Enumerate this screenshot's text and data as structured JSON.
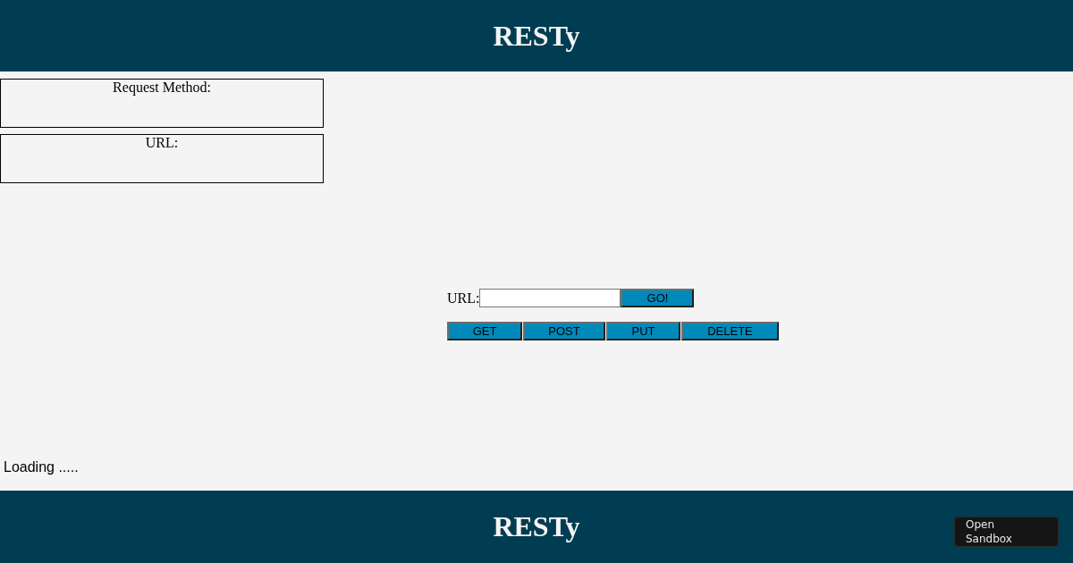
{
  "header": {
    "title": "RESTy"
  },
  "summary": [
    {
      "label": "Request Method:"
    },
    {
      "label": "URL:"
    }
  ],
  "form": {
    "url_label": "URL:",
    "submit_button": "GO!",
    "methods": [
      {
        "label": "GET"
      },
      {
        "label": "POST"
      },
      {
        "label": "PUT"
      },
      {
        "label": "DELETE"
      }
    ]
  },
  "status": "Loading .....",
  "footer": {
    "title": "RESTy"
  },
  "sandbox_button": "Open Sandbox"
}
